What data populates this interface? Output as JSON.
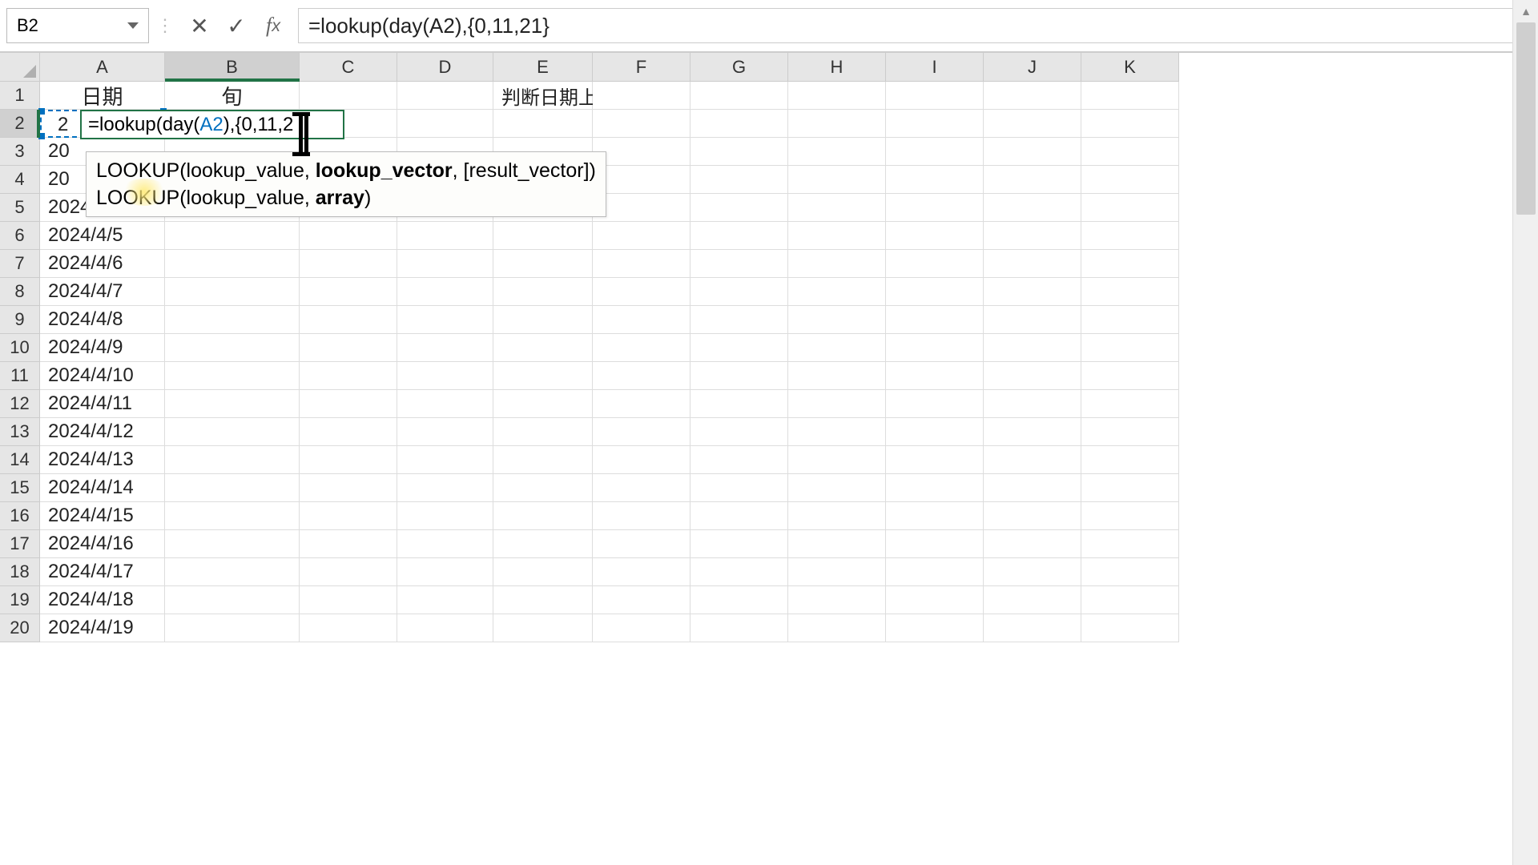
{
  "nameBox": {
    "value": "B2"
  },
  "formulaBar": {
    "formula": "=lookup(day(A2),{0,11,21}"
  },
  "columns": [
    "A",
    "B",
    "C",
    "D",
    "E",
    "F",
    "G",
    "H",
    "I",
    "J",
    "K"
  ],
  "activeColumn": "B",
  "activeRow": 2,
  "headers": {
    "A1": "日期",
    "B1": "旬",
    "E1": "判断日期上中下旬"
  },
  "editCell": {
    "prefix": "2",
    "func_eq": "=lookup(day(",
    "ref": "A2",
    "suffix1": "),{0,11,2",
    "suffix2": "1}"
  },
  "tooltip": {
    "line1_prefix": "LOOKUP(lookup_value, ",
    "line1_bold": "lookup_vector",
    "line1_suffix": ", [result_vector])",
    "line2_prefix": "LOOKUP(lookup_value, ",
    "line2_bold": "array",
    "line2_suffix": ")"
  },
  "colA": {
    "r3": "20",
    "r4": "20",
    "r5": "2024/4/4",
    "r6": "2024/4/5",
    "r7": "2024/4/6",
    "r8": "2024/4/7",
    "r9": "2024/4/8",
    "r10": "2024/4/9",
    "r11": "2024/4/10",
    "r12": "2024/4/11",
    "r13": "2024/4/12",
    "r14": "2024/4/13",
    "r15": "2024/4/14",
    "r16": "2024/4/15",
    "r17": "2024/4/16",
    "r18": "2024/4/17",
    "r19": "2024/4/18",
    "r20": "2024/4/19"
  },
  "rowCount": 20
}
